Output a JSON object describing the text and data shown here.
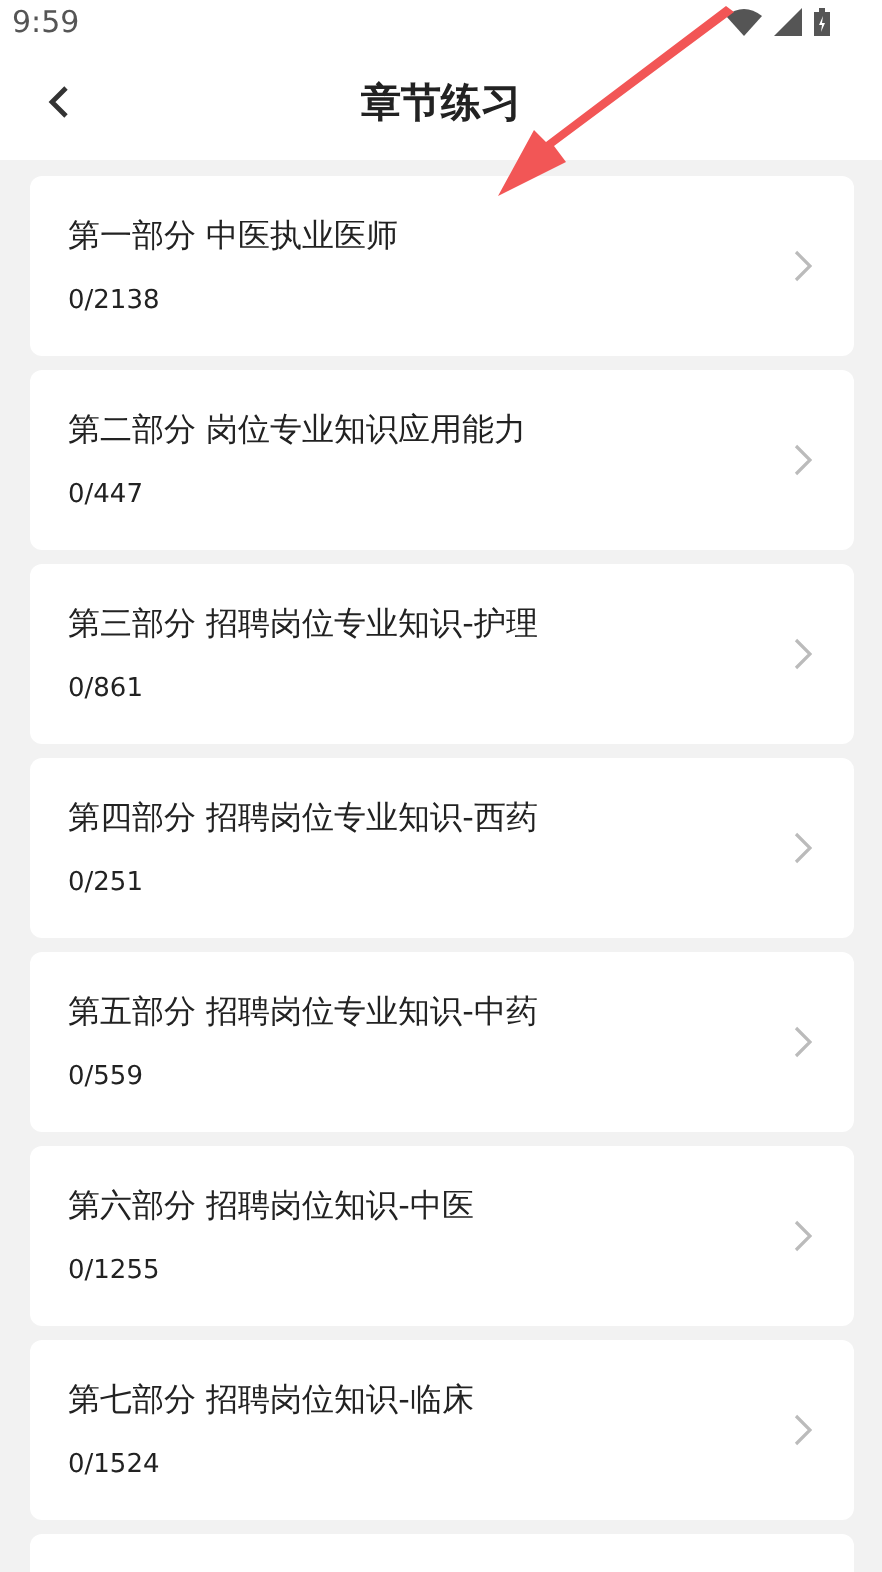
{
  "status_bar": {
    "time": "9:59"
  },
  "header": {
    "title": "章节练习"
  },
  "chapters": [
    {
      "title": "第一部分 中医执业医师",
      "count": "0/2138"
    },
    {
      "title": "第二部分 岗位专业知识应用能力",
      "count": "0/447"
    },
    {
      "title": "第三部分 招聘岗位专业知识-护理",
      "count": "0/861"
    },
    {
      "title": "第四部分 招聘岗位专业知识-西药",
      "count": "0/251"
    },
    {
      "title": "第五部分 招聘岗位专业知识-中药",
      "count": "0/559"
    },
    {
      "title": "第六部分 招聘岗位知识-中医",
      "count": "0/1255"
    },
    {
      "title": "第七部分 招聘岗位知识-临床",
      "count": "0/1524"
    }
  ]
}
